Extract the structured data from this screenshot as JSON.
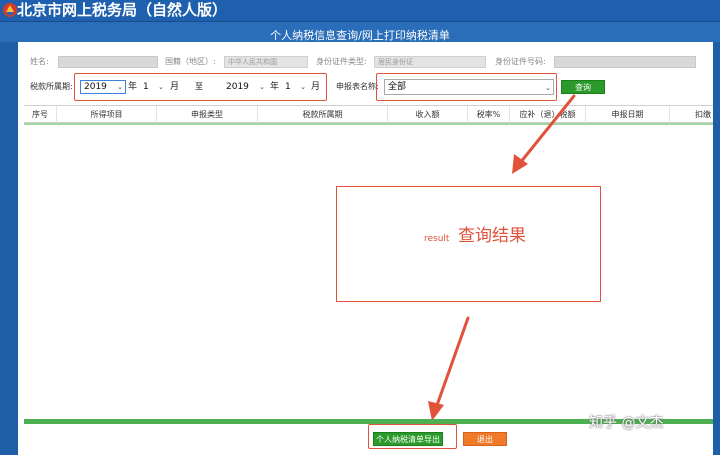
{
  "header": {
    "site_title": "北京市网上税务局（自然人版）",
    "page_title": "个人纳税信息查询/网上打印纳税清单"
  },
  "info": {
    "name_label": "姓名:",
    "nationality_label": "国籍（地区）:",
    "nationality_value": "中华人民共和国",
    "id_type_label": "身份证件类型:",
    "id_type_value": "居民身份证",
    "id_number_label": "身份证件号码:"
  },
  "filter": {
    "period_label": "税款所属期:",
    "start_year": "2019",
    "start_year_unit": "年",
    "start_month": "1",
    "start_month_unit": "月",
    "to_label": "至",
    "end_year": "2019",
    "end_year_unit": "年",
    "end_month": "1",
    "end_month_unit": "月",
    "report_name_label": "申报表名称:",
    "report_name_value": "全部",
    "query_button": "查询"
  },
  "table": {
    "columns": [
      "序号",
      "所得项目",
      "申报类型",
      "税款所属期",
      "收入额",
      "税率%",
      "应补（退）税额",
      "申报日期",
      "扣缴"
    ]
  },
  "annotation": {
    "result_small": "result",
    "result_big": "查询结果"
  },
  "footer": {
    "export_button": "个人纳税清单导出",
    "exit_button": "退出"
  },
  "watermark": "知乎 @文杰",
  "colors": {
    "header_blue": "#1e5fae",
    "accent_red": "#e0523a",
    "button_green": "#2a9a2a",
    "button_orange": "#ee7a2a"
  }
}
